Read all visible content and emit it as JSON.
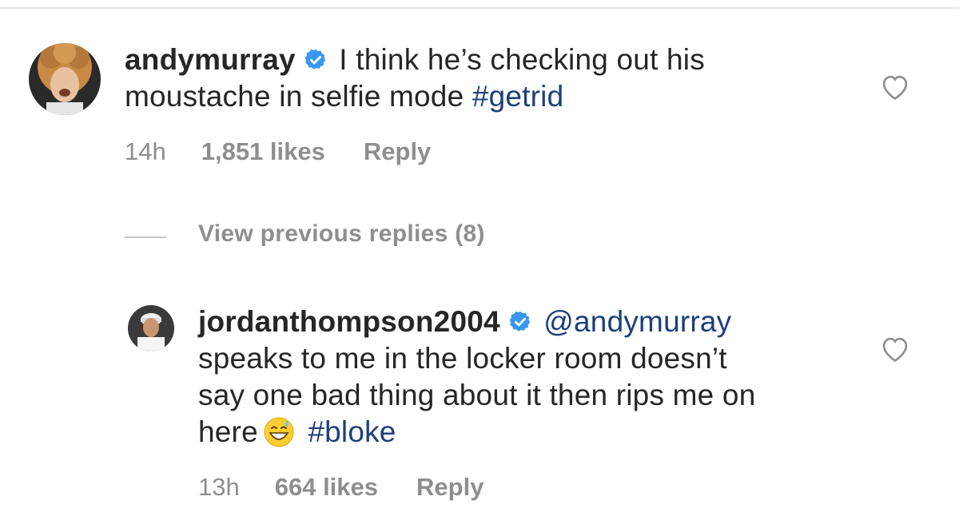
{
  "comments": [
    {
      "username": "andymurray",
      "verified": true,
      "text_line1": " I think he’s checking out his",
      "text_line2": "moustache in selfie mode ",
      "hashtag": "#getrid",
      "time": "14h",
      "likes": "1,851 likes",
      "reply": "Reply"
    },
    {
      "username": "jordanthompson2004",
      "verified": true,
      "mention": "@andymurray",
      "text_line1": "speaks to me in the locker room doesn’t",
      "text_line2": "say one bad thing about it then rips me on",
      "text_line3": "here",
      "emoji": "grinning-face-with-sweat-emoji",
      "hashtag": "#bloke",
      "time": "13h",
      "likes": "664 likes",
      "reply": "Reply"
    }
  ],
  "view_previous": "View previous replies (8)",
  "colors": {
    "link": "#1d3f7a",
    "muted": "#8e8e8e",
    "verified": "#3897f0",
    "text": "#262626"
  },
  "icons": [
    "verified-badge-icon",
    "heart-outline-icon"
  ]
}
